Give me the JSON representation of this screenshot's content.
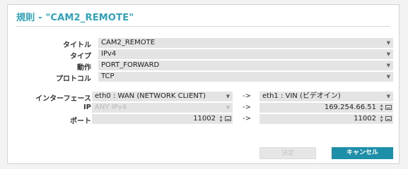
{
  "dialog": {
    "title": "規則 - \"CAM2_REMOTE\""
  },
  "form": {
    "title_label": "タイトル",
    "title_value": "CAM2_REMOTE",
    "type_label": "タイプ",
    "type_value": "IPv4",
    "action_label": "動作",
    "action_value": "PORT_FORWARD",
    "protocol_label": "プロトコル",
    "protocol_value": "TCP",
    "interface_label": "インターフェース",
    "interface_src": "eth0 : WAN (NETWORK CLIENT)",
    "interface_dst": "eth1 : VIN (ビデオイン)",
    "ip_label": "IP",
    "ip_src": "ANY IPv4",
    "ip_dst": "169.254.66.51",
    "port_label": "ポート",
    "port_src": "11002",
    "port_dst": "11002",
    "arrow": "->"
  },
  "buttons": {
    "ok": "決定",
    "cancel": "キャンセル"
  },
  "colors": {
    "accent": "#2ea3ba",
    "cancel_bg": "#1e8fa8"
  }
}
